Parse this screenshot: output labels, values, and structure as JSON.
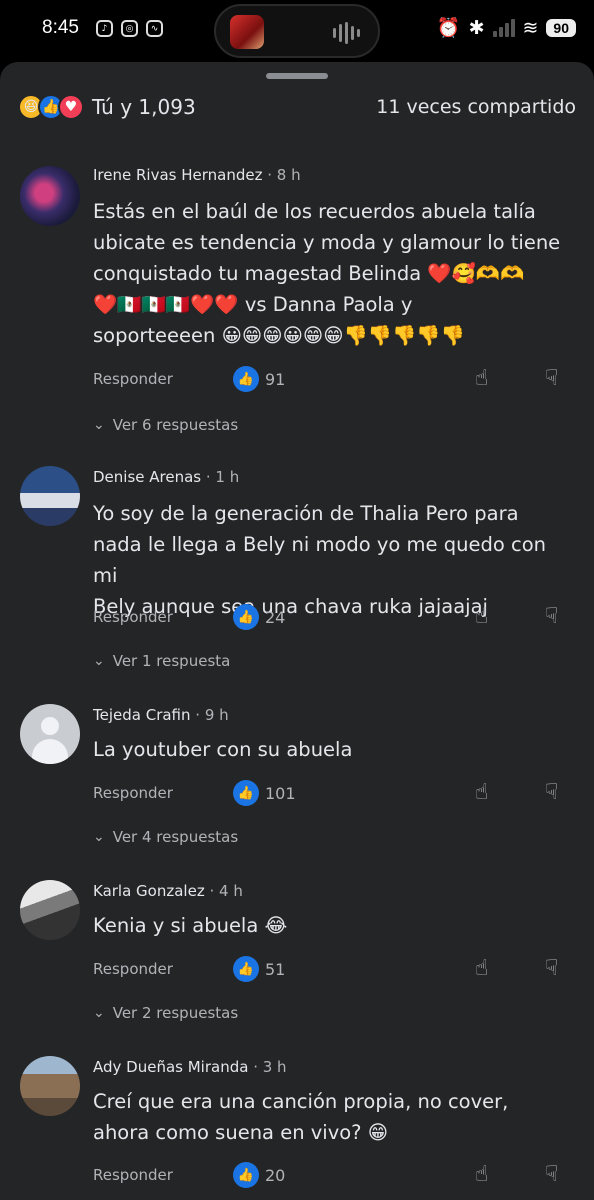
{
  "status_bar": {
    "time": "8:45",
    "battery": "90"
  },
  "post": {
    "reactions_text": "Tú y 1,093",
    "shares_text": "11 veces compartido"
  },
  "comments": [
    {
      "author": "Irene Rivas Hernandez",
      "time": " · 8 h",
      "lines": [
        "Estás en el baúl de los recuerdos abuela talía",
        "ubicate es tendencia y moda y glamour lo tiene",
        "conquistado tu magestad Belinda ❤️🥰🫶🫶",
        "❤️🇲🇽🇲🇽🇲🇽❤️❤️ vs Danna Paola y",
        "soporteeeen 😀😁😁😀😁😁👎👎👎👎👎"
      ],
      "reply_label": "Responder",
      "likes": "91",
      "replies_label": "Ver 6 respuestas"
    },
    {
      "author": "Denise Arenas",
      "time": " · 1 h",
      "lines": [
        "Yo soy de la generación de Thalia Pero para",
        "nada le llega a Bely ni modo yo me quedo con mi",
        "Bely aunque sea una chava ruka jajaajaj"
      ],
      "reply_label": "Responder",
      "likes": "24",
      "replies_label": "Ver 1 respuesta"
    },
    {
      "author": "Tejeda Crafin",
      "time": " · 9 h",
      "lines": [
        "La youtuber con su abuela"
      ],
      "reply_label": "Responder",
      "likes": "101",
      "replies_label": "Ver 4 respuestas"
    },
    {
      "author": "Karla Gonzalez",
      "time": " · 4 h",
      "lines": [
        "Kenia y si abuela 😂"
      ],
      "reply_label": "Responder",
      "likes": "51",
      "replies_label": "Ver 2 respuestas"
    },
    {
      "author": "Ady Dueñas Miranda",
      "time": " · 3 h",
      "lines": [
        "Creí que era una canción propia, no cover,",
        "ahora como suena en vivo? 😁"
      ],
      "reply_label": "Responder",
      "likes": "20",
      "replies_label": ""
    }
  ],
  "icons": {
    "reaction_haha": "😆",
    "reaction_like": "👍",
    "reaction_love": "♥",
    "thumb_up": "👍",
    "thumb_down": "👎",
    "chevron": "⌄"
  },
  "colors": {
    "background": "#242526",
    "text": "#e4e6eb",
    "muted": "#b0b3b8",
    "like_blue": "#1b74e4"
  }
}
